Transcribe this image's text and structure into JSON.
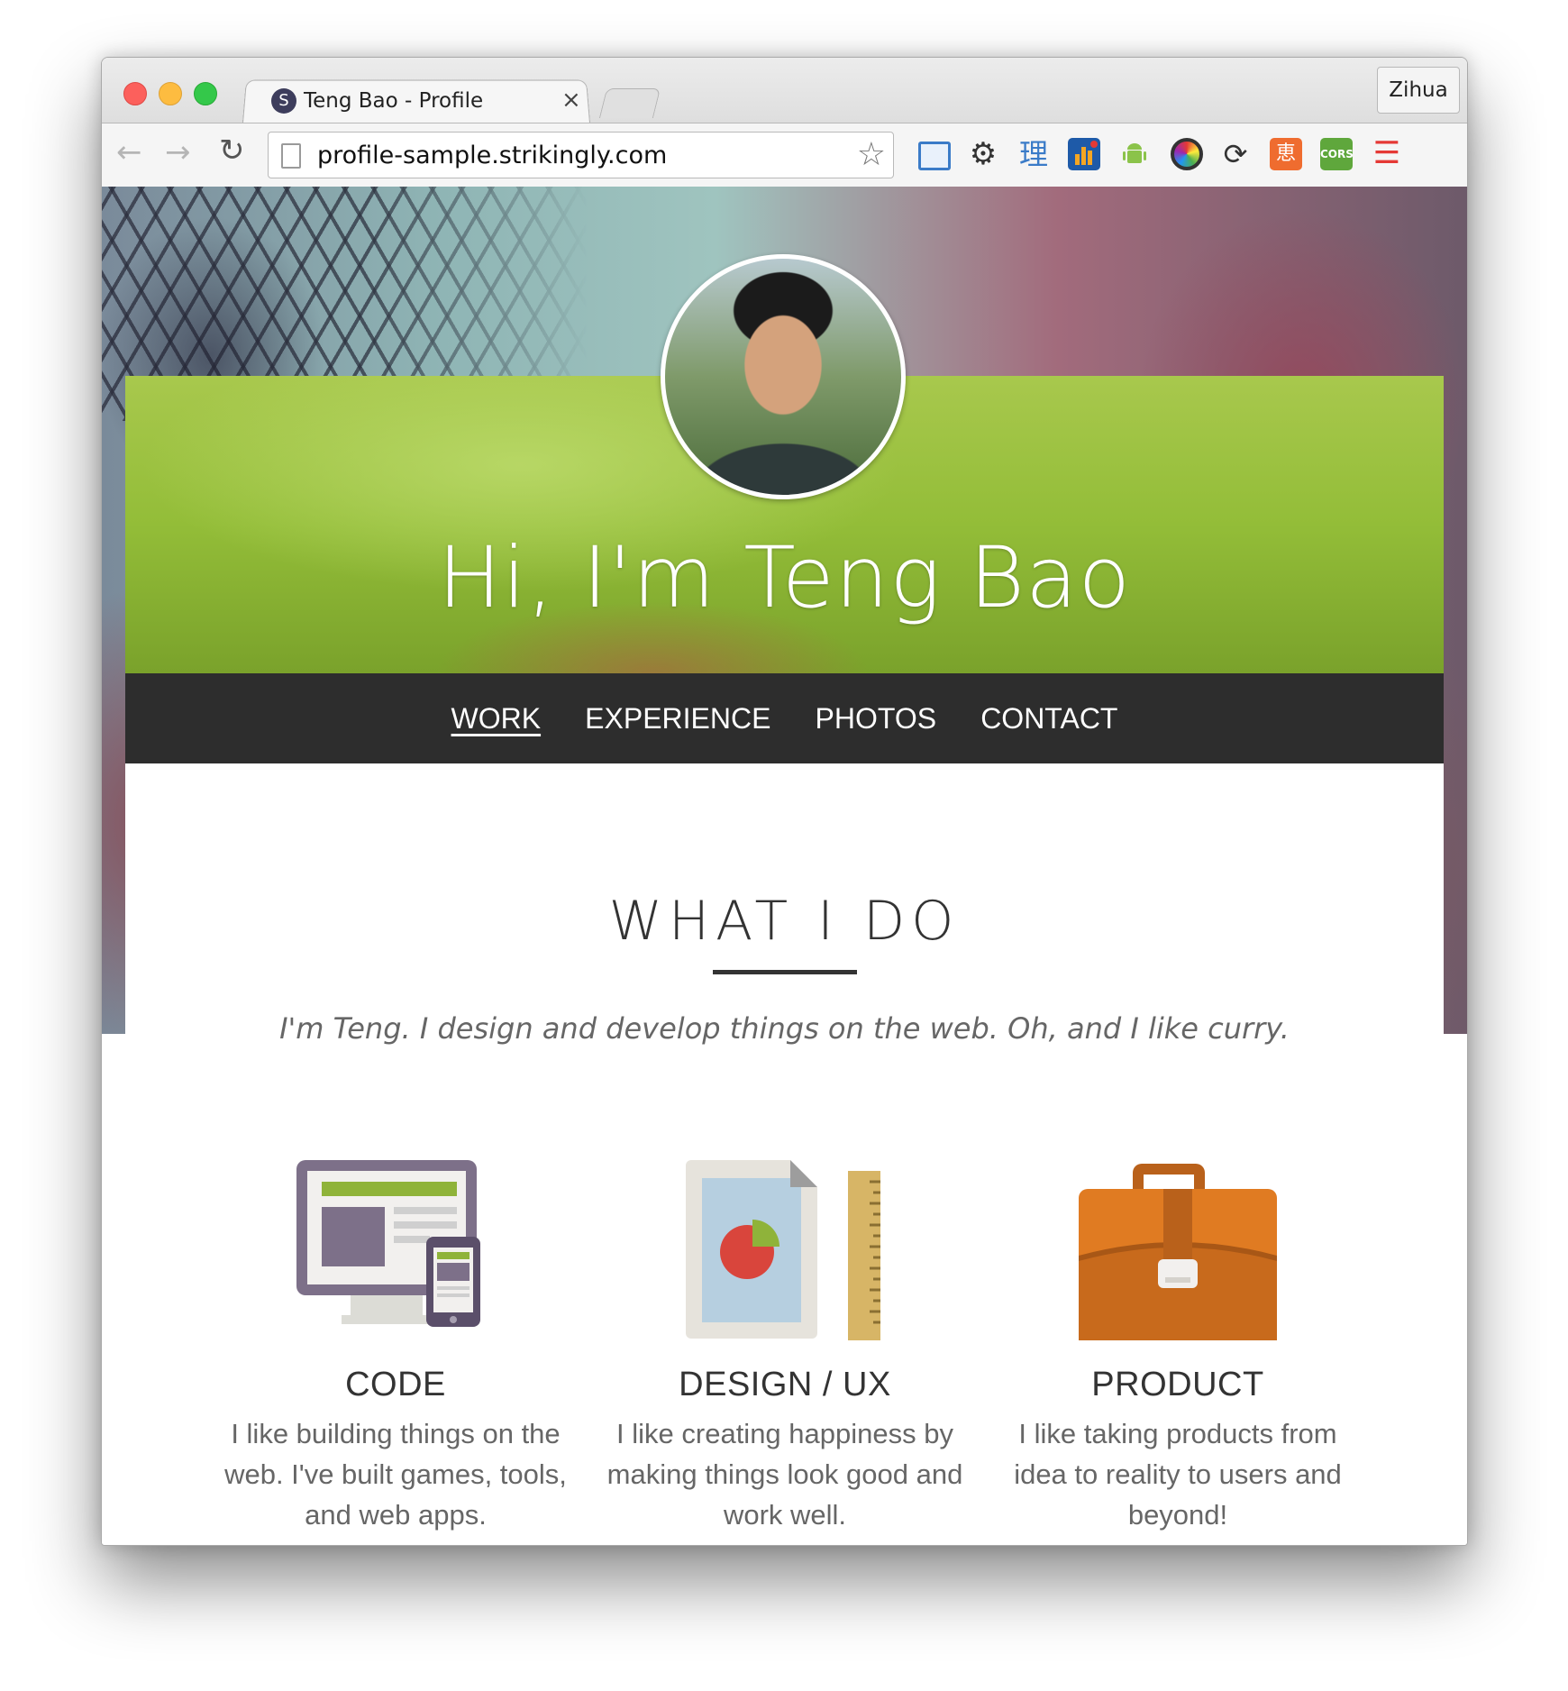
{
  "browser": {
    "tab_title": "Teng Bao - Profile",
    "tab_favicon_letter": "S",
    "tab_close": "×",
    "profile_name": "Zihua",
    "url": "profile-sample.strikingly.com",
    "extensions": [
      "screen-capture-icon",
      "settings-gear-icon",
      "li-char-icon",
      "stats-icon",
      "android-icon",
      "color-wheel-icon",
      "sync-icon",
      "su-char-icon",
      "cors-icon",
      "menu-icon"
    ],
    "ext_labels": {
      "li": "理",
      "su": "恵",
      "cors": "CORS"
    }
  },
  "hero": {
    "title": "Hi, I'm Teng Bao"
  },
  "nav": {
    "items": [
      "WORK",
      "EXPERIENCE",
      "PHOTOS",
      "CONTACT"
    ],
    "active": "WORK"
  },
  "section": {
    "title": "WHAT I DO",
    "tagline": "I'm Teng. I design and develop things on the web. Oh, and I like curry.",
    "columns": [
      {
        "title": "CODE",
        "desc": "I like building things on the web. I've built games, tools, and web apps.",
        "icon": "computer-devices-icon"
      },
      {
        "title": "DESIGN / UX",
        "desc": "I like creating happiness by making things look good and work well.",
        "icon": "design-document-icon"
      },
      {
        "title": "PRODUCT",
        "desc": "I like taking products from idea to reality to users and beyond!",
        "icon": "briefcase-icon"
      }
    ]
  },
  "colors": {
    "nav_bg": "#2d2d2d",
    "banner_green": "#93bd38",
    "briefcase": "#e07b22"
  }
}
